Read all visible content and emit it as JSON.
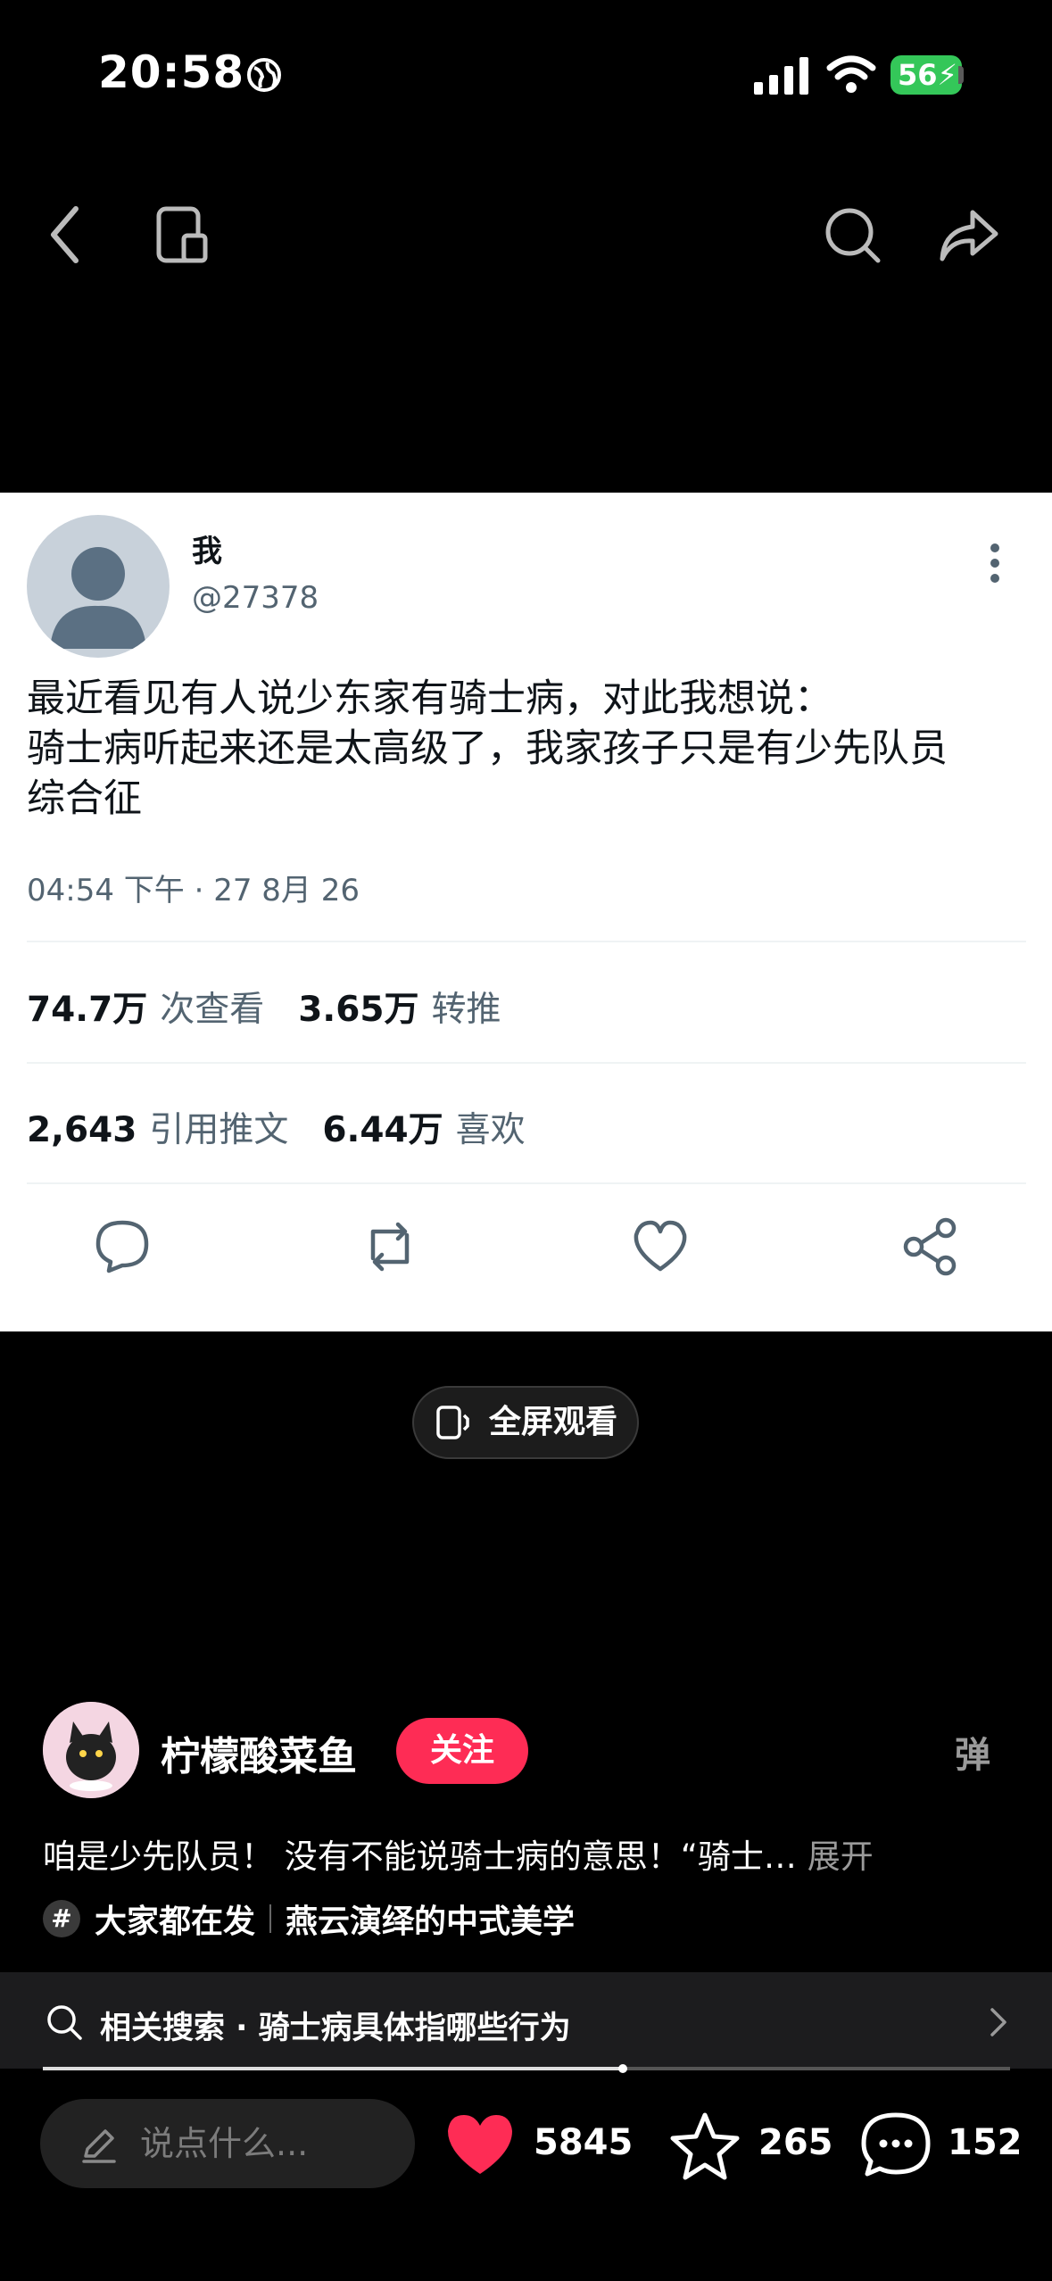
{
  "status_bar": {
    "time": "20:58",
    "battery": "56"
  },
  "tweet": {
    "author_name": "我",
    "handle": "@27378",
    "text_line1": "最近看见有人说少东家有骑士病，对此我想说：",
    "text_line2": "骑士病听起来还是太高级了，我家孩子只是有少先队员",
    "text_line3": "综合征",
    "meta": "04:54 下午 · 27 8月 26",
    "views_value": "74.7万",
    "views_label": "次查看",
    "retweets_value": "3.65万",
    "retweets_label": "转推",
    "quotes_value": "2,643",
    "quotes_label": "引用推文",
    "likes_value": "6.44万",
    "likes_label": "喜欢"
  },
  "video": {
    "fullscreen_label": "全屏观看",
    "author_name": "柠檬酸菜鱼",
    "follow_label": "关注",
    "danmu_label": "弹",
    "caption": "咱是少先队员！ 没有不能说骑士病的意思！“骑士…",
    "caption_more": "展开",
    "tag1": "大家都在发",
    "tag2": "燕云演绎的中式美学",
    "related_search": "相关搜索 · 骑士病具体指哪些行为",
    "progress": 0.6
  },
  "bottom_bar": {
    "comment_placeholder": "说点什么...",
    "likes": "5845",
    "favorites": "265",
    "comments": "152"
  },
  "colors": {
    "like_red": "#fe2c55",
    "battery_green": "#34c759",
    "follow_red": "#fe2c55"
  }
}
